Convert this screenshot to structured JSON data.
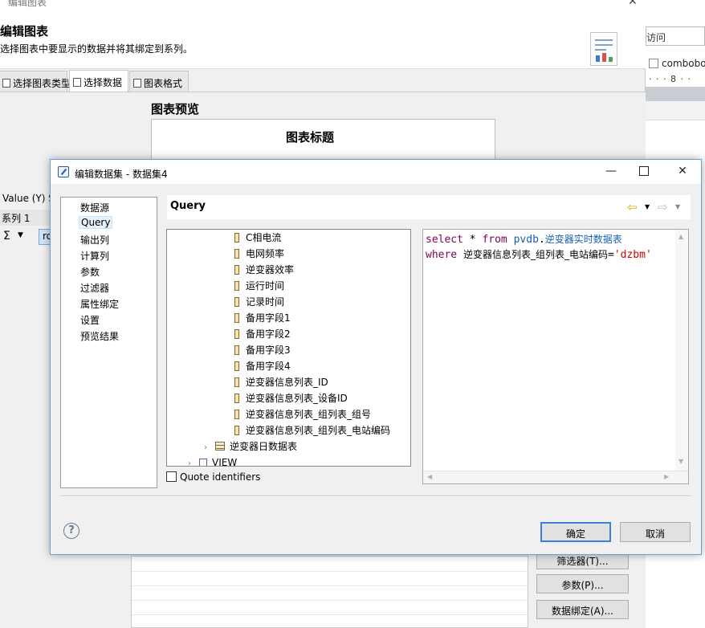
{
  "background_dialog": {
    "title": "编辑图表",
    "heading": "编辑图表",
    "description": "选择图表中要显示的数据并将其绑定到系列。",
    "tabs": [
      "选择图表类型",
      "选择数据",
      "图表格式"
    ],
    "preview_label": "图表预览",
    "chart_title": "图表标题",
    "value_label": "Value (Y) S",
    "series_label": "系列 1",
    "sigma": "Σ",
    "field_value": "ro",
    "buttons": {
      "filter": "筛选器(T)...",
      "params": "参数(P)...",
      "binding": "数据绑定(A)..."
    }
  },
  "right_editor": {
    "search_text": "访问",
    "combo_text": "combobo",
    "ruler_text": "· · · 8 · ·"
  },
  "dialog": {
    "title": "编辑数据集 - 数据集4",
    "nav": {
      "items": [
        "数据源",
        "Query",
        "输出列",
        "计算列",
        "参数",
        "过滤器",
        "属性绑定",
        "设置",
        "预览结果"
      ],
      "selected": "Query"
    },
    "query_title": "Query",
    "tree": {
      "columns": [
        "C相电流",
        "电网频率",
        "逆变器效率",
        "运行时间",
        "记录时间",
        "备用字段1",
        "备用字段2",
        "备用字段3",
        "备用字段4",
        "逆变器信息列表_ID",
        "逆变器信息列表_设备ID",
        "逆变器信息列表_组列表_组号",
        "逆变器信息列表_组列表_电站编码"
      ],
      "table": "逆变器日数据表",
      "view": "VIEW"
    },
    "quote_identifiers": "Quote identifiers",
    "sql": {
      "line1": {
        "kw_select": "select",
        "star": "*",
        "kw_from": "from",
        "schema": "pvdb",
        "dot": ".",
        "table": "逆变器实时数据表"
      },
      "line2": {
        "kw_where": "where",
        "column": "逆变器信息列表_组列表_电站编码",
        "eq": "=",
        "value": "'dzbm'"
      }
    },
    "help": "?",
    "ok_button": "确定",
    "cancel_button": "取消"
  }
}
